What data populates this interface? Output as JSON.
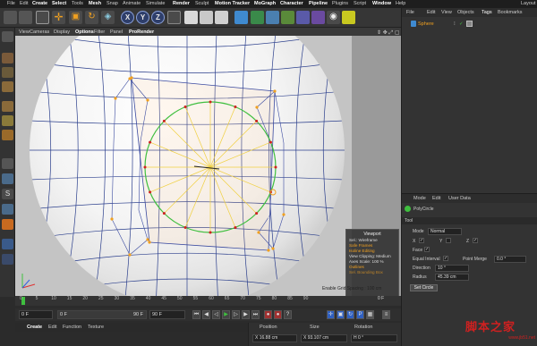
{
  "menubar": {
    "items": [
      "File",
      "Edit",
      "Create",
      "Select",
      "Tools",
      "Mesh",
      "Snap",
      "Animate",
      "Simulate",
      "Render",
      "Sculpt",
      "Motion Tracker",
      "MoGraph",
      "Character",
      "Pipeline",
      "Plugins",
      "Script",
      "Window",
      "Help"
    ],
    "layout_label": "Layout"
  },
  "toolbar": {
    "axis_x": "X",
    "axis_y": "Y",
    "axis_z": "Z"
  },
  "viewport": {
    "menu": [
      "View",
      "Cameras",
      "Display",
      "Options",
      "Filter",
      "Panel",
      "ProRender"
    ],
    "active_menu": "Options",
    "hud": {
      "title": "Viewport",
      "lines": [
        "Sel.: Wireframe",
        "Safe Frames",
        "Isoline Editing",
        "View Clipping: Medium",
        "Axes Scale: 100 %",
        "Outlines",
        "Sel. Bounding Box"
      ],
      "orange_lines": [
        1,
        2,
        5,
        6
      ]
    },
    "grid_spacing": "Grid Spacing : 100 cm",
    "hud_enable": "Enable"
  },
  "timeline": {
    "ticks": [
      "0",
      "5",
      "10",
      "15",
      "20",
      "25",
      "30",
      "35",
      "40",
      "45",
      "50",
      "55",
      "60",
      "65",
      "70",
      "75",
      "80",
      "85",
      "90"
    ],
    "frame_end_label": "0 F"
  },
  "transport": {
    "current_frame": "0 F",
    "start_frame": "0 F",
    "end_frame": "90 F",
    "max_frame": "90 F"
  },
  "material_manager": {
    "menu": [
      "Create",
      "Edit",
      "Function",
      "Texture"
    ],
    "active_menu": "Create"
  },
  "coordinates": {
    "headers": [
      "Position",
      "Size",
      "Rotation"
    ],
    "values": [
      "X  16.88 cm",
      "X  93.107 cm",
      "H  0 °"
    ]
  },
  "object_manager": {
    "menu": [
      "File",
      "Edit",
      "View",
      "Objects",
      "Tags",
      "Bookmarks"
    ],
    "active_menu": "Tags",
    "objects": [
      {
        "name": "Sphere"
      }
    ]
  },
  "attribute_manager": {
    "menu": [
      "Mode",
      "Edit",
      "User Data"
    ],
    "tool_name": "PolyCircle",
    "section": "Tool",
    "mode_label": "Mode",
    "mode_value": "Normal",
    "axis_labels": [
      "X",
      "Y",
      "Z"
    ],
    "face_label": "Face",
    "equal_interval_label": "Equal Interval",
    "point_merge_label": "Point Merge",
    "point_merge_value": "0.0 °",
    "direction_label": "Direction",
    "direction_value": "10 °",
    "radius_label": "Radius",
    "radius_value": "45.39 cm",
    "set_circle_button": "Set Circle"
  },
  "watermark": {
    "text": "脚本之家",
    "url": "www.jb51.net"
  },
  "colors": {
    "accent_orange": "#f0a020",
    "selection_green": "#3fbf3f",
    "viewport_bg": "#c4c4c4",
    "ui_dark": "#333333"
  }
}
